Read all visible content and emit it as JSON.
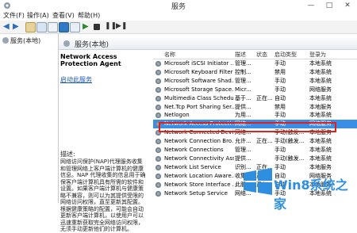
{
  "window": {
    "title": "服务",
    "minimize": "—",
    "maximize": "□",
    "close": "✕"
  },
  "menu": {
    "items": [
      "文件(F)",
      "操作(A)",
      "查看(V)",
      "帮助(H)"
    ]
  },
  "tree": {
    "item": "服务(本地)"
  },
  "header": {
    "title": "服务(本地)"
  },
  "details": {
    "service_name": "Network Access Protection Agent",
    "start_link": "启动此服务",
    "desc_label": "描述:",
    "desc_text": "网络访问保护(NAP)代理服务收集和管理网络上客户端计算机的健康信息。NAP 代理收集的信息用于确保客户端计算机具有所需的软件和设置。如果客户端计算机与健康策略不兼容，则可以为其提供受限的网络访问权限，直至更新其配置。根据健康策略的配置，可能会自动更新客户端计算机，以使用户可以迅速重新获取完全网络访问权限，无须手动更新他们的计算机。"
  },
  "list": {
    "columns": [
      "名称",
      "描述",
      "状态",
      "启动类型",
      "登录为"
    ],
    "rows": [
      [
        "Microsoft iSCSI Initiator ...",
        "管理...",
        "",
        "手动",
        "本地系统"
      ],
      [
        "Microsoft Keyboard Filter",
        "控制...",
        "",
        "禁用",
        "本地系统"
      ],
      [
        "Microsoft Software Shad...",
        "管理...",
        "",
        "手动",
        "本地系统"
      ],
      [
        "Microsoft Storage Space...",
        "Micr...",
        "",
        "手动",
        "网络服务"
      ],
      [
        "Multimedia Class Schedul...",
        "基于...",
        "正在...",
        "自动",
        "本地系统"
      ],
      [
        "Net.Tcp Port Sharing Ser...",
        "提供...",
        "",
        "禁用",
        "本地服务"
      ],
      [
        "Netlogon",
        "为用...",
        "",
        "手动",
        "本地系统"
      ],
      [
        "Network Access Protecti...",
        "网络...",
        "",
        "手动",
        "网络服务"
      ],
      [
        "Network Connected Devi...",
        "网络...",
        "",
        "手动(触发...",
        "本地服务"
      ],
      [
        "Network Connection Bro...",
        "允许...",
        "正在...",
        "手动(触发...",
        "本地系统"
      ],
      [
        "Network Connections",
        "管理...",
        "",
        "手动",
        "本地系统"
      ],
      [
        "Network Connectivity Ass...",
        "提供...",
        "",
        "手动(触发...",
        "本地系统"
      ],
      [
        "Network List Service",
        "识别...",
        "正在...",
        "手动",
        "本地服务"
      ],
      [
        "Network Location Aware...",
        "收集...",
        "正在...",
        "自动",
        "网络服务"
      ],
      [
        "Network Store Interface ...",
        "此服...",
        "正在...",
        "自动",
        "本地服务"
      ],
      [
        "Network Setup Service",
        "网络...",
        "",
        "手动",
        "本地系统"
      ]
    ],
    "selected_index": 7
  },
  "watermark": {
    "text": "Win8系统之家"
  },
  "colors": {
    "selection": "#3a8ee6",
    "highlight_outline": "#e0201c",
    "link": "#1a57b8"
  }
}
